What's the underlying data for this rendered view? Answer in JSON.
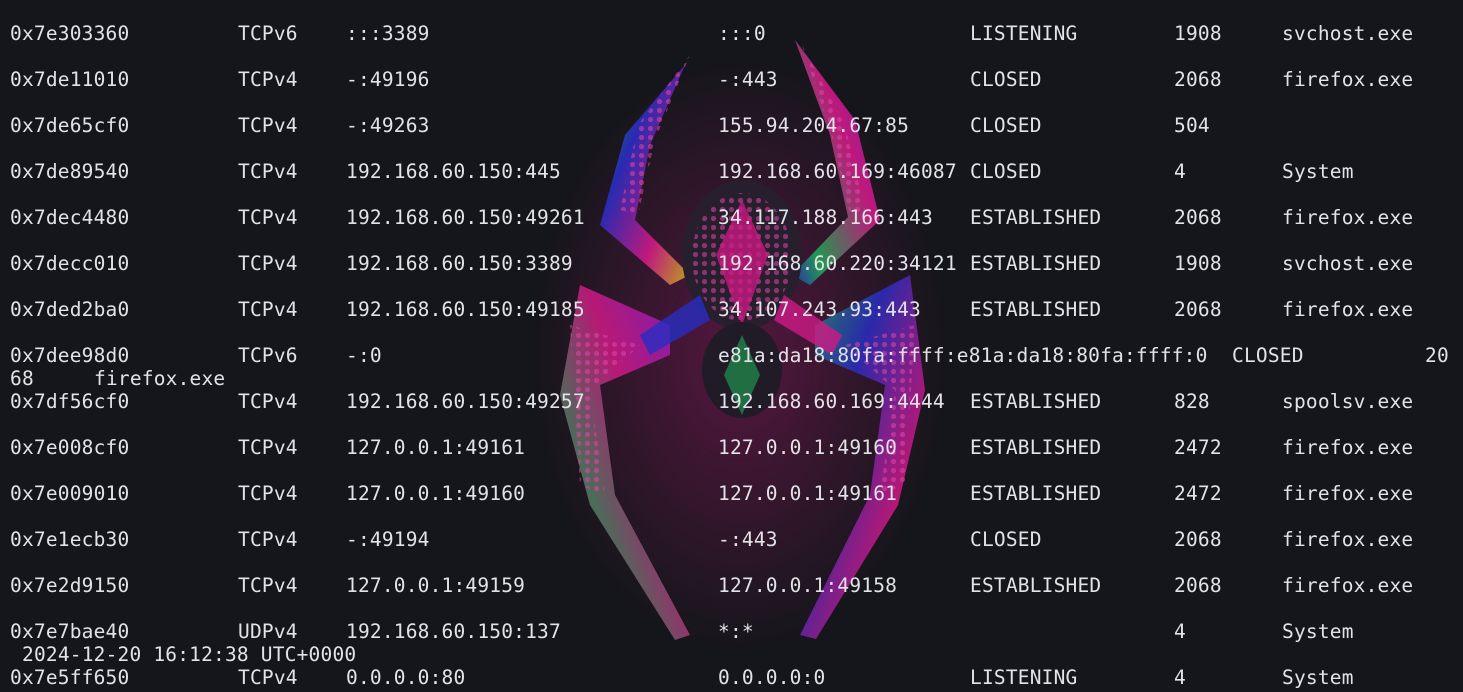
{
  "connections": [
    {
      "offset": "0x7e303360",
      "proto": "TCPv6",
      "local": ":::3389",
      "foreign": ":::0",
      "state": "LISTENING",
      "pid": "1908",
      "owner": "svchost.exe"
    },
    {
      "offset": "0x7de11010",
      "proto": "TCPv4",
      "local": "-:49196",
      "foreign": "-:443",
      "state": "CLOSED",
      "pid": "2068",
      "owner": "firefox.exe"
    },
    {
      "offset": "0x7de65cf0",
      "proto": "TCPv4",
      "local": "-:49263",
      "foreign": "155.94.204.67:85",
      "state": "CLOSED",
      "pid": "504",
      "owner": ""
    },
    {
      "offset": "0x7de89540",
      "proto": "TCPv4",
      "local": "192.168.60.150:445",
      "foreign": "192.168.60.169:46087",
      "state": "CLOSED",
      "pid": "4",
      "owner": "System"
    },
    {
      "offset": "0x7dec4480",
      "proto": "TCPv4",
      "local": "192.168.60.150:49261",
      "foreign": "34.117.188.166:443",
      "state": "ESTABLISHED",
      "pid": "2068",
      "owner": "firefox.exe"
    },
    {
      "offset": "0x7decc010",
      "proto": "TCPv4",
      "local": "192.168.60.150:3389",
      "foreign": "192.168.60.220:34121",
      "state": "ESTABLISHED",
      "pid": "1908",
      "owner": "svchost.exe"
    },
    {
      "offset": "0x7ded2ba0",
      "proto": "TCPv4",
      "local": "192.168.60.150:49185",
      "foreign": "34.107.243.93:443",
      "state": "ESTABLISHED",
      "pid": "2068",
      "owner": "firefox.exe"
    },
    {
      "offset": "0x7dee98d0",
      "proto": "TCPv6",
      "local": "-:0",
      "foreign": "e81a:da18:80fa:ffff:e81a:da18:80fa:ffff:0",
      "state": "CLOSED",
      "pid": "20",
      "pid_wrap": "68",
      "owner": "firefox.exe"
    },
    {
      "offset": "0x7df56cf0",
      "proto": "TCPv4",
      "local": "192.168.60.150:49257",
      "foreign": "192.168.60.169:4444",
      "state": "ESTABLISHED",
      "pid": "828",
      "owner": "spoolsv.exe"
    },
    {
      "offset": "0x7e008cf0",
      "proto": "TCPv4",
      "local": "127.0.0.1:49161",
      "foreign": "127.0.0.1:49160",
      "state": "ESTABLISHED",
      "pid": "2472",
      "owner": "firefox.exe"
    },
    {
      "offset": "0x7e009010",
      "proto": "TCPv4",
      "local": "127.0.0.1:49160",
      "foreign": "127.0.0.1:49161",
      "state": "ESTABLISHED",
      "pid": "2472",
      "owner": "firefox.exe"
    },
    {
      "offset": "0x7e1ecb30",
      "proto": "TCPv4",
      "local": "-:49194",
      "foreign": "-:443",
      "state": "CLOSED",
      "pid": "2068",
      "owner": "firefox.exe"
    },
    {
      "offset": "0x7e2d9150",
      "proto": "TCPv4",
      "local": "127.0.0.1:49159",
      "foreign": "127.0.0.1:49158",
      "state": "ESTABLISHED",
      "pid": "2068",
      "owner": "firefox.exe"
    },
    {
      "offset": "0x7e7bae40",
      "proto": "UDPv4",
      "local": "192.168.60.150:137",
      "foreign": "*:*",
      "state": "",
      "pid": "4",
      "owner": "System",
      "created": "2024-12-20 16:12:38 UTC+0000"
    },
    {
      "offset": "0x7e5ff650",
      "proto": "TCPv4",
      "local": "0.0.0.0:80",
      "foreign": "0.0.0.0:0",
      "state": "LISTENING",
      "pid": "4",
      "owner": "System"
    }
  ],
  "background": {
    "image_name": "spider-emblem-wallpaper",
    "colors": [
      "#e01a8e",
      "#2b2fd0",
      "#1fb35a",
      "#d8c21a",
      "#8a1fe0"
    ]
  }
}
